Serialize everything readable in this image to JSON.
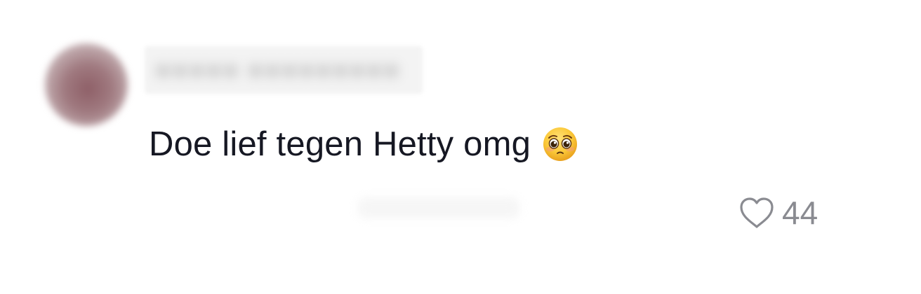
{
  "comment": {
    "text": "Doe lief tegen Hetty omg",
    "emoji": "pleading-face-icon",
    "likes": "44"
  }
}
